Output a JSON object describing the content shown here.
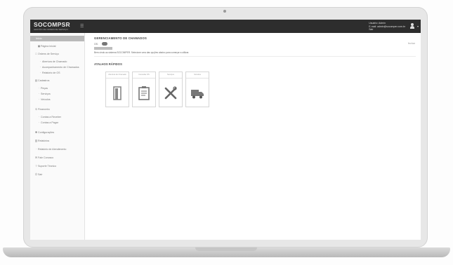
{
  "app": {
    "logo_text": "SOCOMPSR",
    "logo_sub": "GESTÃO DE ORDEM DE SERVIÇO",
    "menu_icon": "hamburger-icon"
  },
  "user": {
    "line1": "Usuário: Admin",
    "line2": "E-mail: admin@socomper.com.br",
    "line3": "Sair",
    "avatar_icon": "user-icon",
    "dropdown_icon": "caret-down-icon"
  },
  "sidebar": {
    "items": [
      {
        "label": "Início",
        "icon": "home-icon",
        "active": true
      },
      {
        "label": "Página Inicial",
        "icon": "dashboard-icon"
      },
      {
        "label": "Ordens de Serviço",
        "icon": "clipboard-icon"
      },
      {
        "label": "Abertura de Chamado",
        "icon": "dot-icon"
      },
      {
        "label": "Acompanhamento de Chamados",
        "icon": "dot-icon"
      },
      {
        "label": "Relatório de OS",
        "icon": "dot-icon"
      },
      {
        "label": "Cadastros",
        "icon": "folder-icon"
      },
      {
        "label": "Peças",
        "icon": "dot-icon"
      },
      {
        "label": "Serviços",
        "icon": "dot-icon"
      },
      {
        "label": "Veículos",
        "icon": "dot-icon"
      },
      {
        "label": "Financeiro",
        "icon": "money-icon"
      },
      {
        "label": "Contas a Receber",
        "icon": "dot-icon"
      },
      {
        "label": "Contas a Pagar",
        "icon": "dot-icon"
      },
      {
        "label": "Configurações",
        "icon": "gear-icon"
      },
      {
        "label": "Relatórios",
        "icon": "report-icon"
      },
      {
        "label": "Relatório de Atendimento",
        "icon": "dot-icon"
      },
      {
        "label": "Fale Conosco",
        "icon": "chat-icon"
      },
      {
        "label": "Suporte Técnico",
        "icon": "help-icon"
      },
      {
        "label": "Sair",
        "icon": "logout-icon"
      }
    ]
  },
  "main": {
    "title": "GERENCIAMENTO DE CHAMADOS",
    "status_prefix": "OS:",
    "info_text": "Bem-vindo ao sistema SOCOMPER. Selecione uma das opções abaixo para começar a utilizar.",
    "close_label": "fechar",
    "shortcuts_title": "ATALHOS RÁPIDOS",
    "shortcuts": [
      {
        "label": "Abertura de Chamado",
        "icon": "door-icon"
      },
      {
        "label": "Consultar OS",
        "icon": "checklist-icon"
      },
      {
        "label": "Serviços",
        "icon": "tools-icon"
      },
      {
        "label": "Veículos",
        "icon": "truck-icon"
      }
    ]
  },
  "colors": {
    "topbar": "#2d2d2d",
    "sidebar_active": "#b9b9b9",
    "icon_gray": "#888888"
  }
}
